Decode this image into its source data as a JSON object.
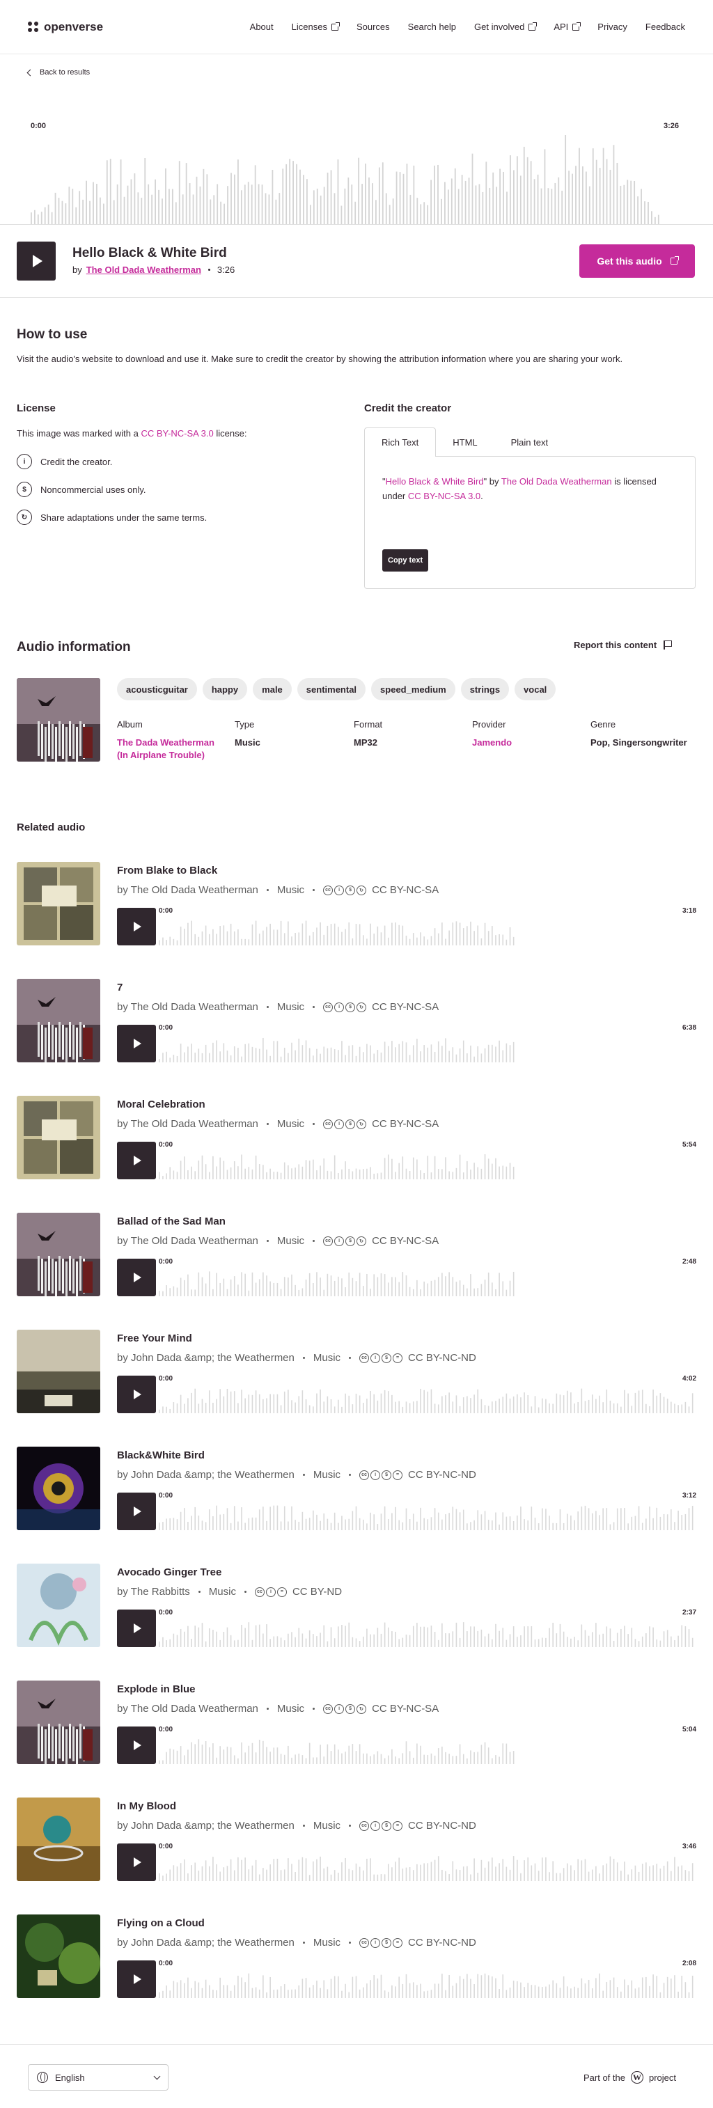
{
  "header": {
    "brand": "openverse",
    "nav": [
      {
        "label": "About",
        "external": false
      },
      {
        "label": "Licenses",
        "external": true
      },
      {
        "label": "Sources",
        "external": false
      },
      {
        "label": "Search help",
        "external": false
      },
      {
        "label": "Get involved",
        "external": true
      },
      {
        "label": "API",
        "external": true
      },
      {
        "label": "Privacy",
        "external": false
      },
      {
        "label": "Feedback",
        "external": false
      }
    ]
  },
  "back_link": "Back to results",
  "player": {
    "current_time": "0:00",
    "duration": "3:26",
    "title": "Hello Black & White Bird",
    "by": "by",
    "creator": "The Old Dada Weatherman",
    "time": "3:26",
    "get_button": "Get this audio"
  },
  "how_to_use": {
    "heading": "How to use",
    "description": "Visit the audio's website to download and use it. Make sure to credit the creator by showing the attribution information where you are sharing your work."
  },
  "license": {
    "heading": "License",
    "intro_prefix": "This image was marked with a",
    "license_name": "CC BY-NC-SA 3.0",
    "intro_suffix": "license:",
    "terms": [
      {
        "icon": "cc-by-icon",
        "glyph": "i",
        "text": "Credit the creator."
      },
      {
        "icon": "cc-nc-icon",
        "glyph": "$",
        "text": "Noncommercial uses only."
      },
      {
        "icon": "cc-sa-icon",
        "glyph": "↻",
        "text": "Share adaptations under the same terms."
      }
    ]
  },
  "credit": {
    "heading": "Credit the creator",
    "tabs": [
      "Rich Text",
      "HTML",
      "Plain text"
    ],
    "active_tab": "Rich Text",
    "quote_open": "\"",
    "title_link": "Hello Black & White Bird",
    "quote_close": "\" by ",
    "creator_link": "The Old Dada Weatherman",
    "middle": " is licensed under ",
    "license_link": "CC BY-NC-SA 3.0",
    "end": ".",
    "copy_button": "Copy text"
  },
  "audio_info": {
    "heading": "Audio information",
    "report": "Report this content",
    "tags": [
      "acousticguitar",
      "happy",
      "male",
      "sentimental",
      "speed_medium",
      "strings",
      "vocal"
    ],
    "meta": [
      {
        "label": "Album",
        "value": "The Dada Weatherman (In Airplane Trouble)",
        "link": true
      },
      {
        "label": "Type",
        "value": "Music",
        "link": false
      },
      {
        "label": "Format",
        "value": "MP32",
        "link": false
      },
      {
        "label": "Provider",
        "value": "Jamendo",
        "link": true
      },
      {
        "label": "Genre",
        "value": "Pop, Singersongwriter",
        "link": false
      }
    ]
  },
  "related": {
    "heading": "Related audio",
    "items": [
      {
        "title": "From Blake to Black",
        "creator": "by The Old Dada Weatherman",
        "type": "Music",
        "icons": [
          "cc",
          "i",
          "$",
          "↻"
        ],
        "license": "CC BY-NC-SA",
        "start": "0:00",
        "duration": "3:18",
        "art": "poster"
      },
      {
        "title": "7",
        "creator": "by The Old Dada Weatherman",
        "type": "Music",
        "icons": [
          "cc",
          "i",
          "$",
          "↻"
        ],
        "license": "CC BY-NC-SA",
        "start": "0:00",
        "duration": "6:38",
        "art": "bird"
      },
      {
        "title": "Moral Celebration",
        "creator": "by The Old Dada Weatherman",
        "type": "Music",
        "icons": [
          "cc",
          "i",
          "$",
          "↻"
        ],
        "license": "CC BY-NC-SA",
        "start": "0:00",
        "duration": "5:54",
        "art": "poster"
      },
      {
        "title": "Ballad of the Sad Man",
        "creator": "by The Old Dada Weatherman",
        "type": "Music",
        "icons": [
          "cc",
          "i",
          "$",
          "↻"
        ],
        "license": "CC BY-NC-SA",
        "start": "0:00",
        "duration": "2:48",
        "art": "bird"
      },
      {
        "title": "Free Your Mind",
        "creator": "by John Dada &amp; the Weathermen",
        "type": "Music",
        "icons": [
          "cc",
          "i",
          "$",
          "="
        ],
        "license": "CC BY-NC-ND",
        "start": "0:00",
        "duration": "4:02",
        "art": "field"
      },
      {
        "title": "Black&White Bird",
        "creator": "by John Dada &amp; the Weathermen",
        "type": "Music",
        "icons": [
          "cc",
          "i",
          "$",
          "="
        ],
        "license": "CC BY-NC-ND",
        "start": "0:00",
        "duration": "3:12",
        "art": "flower"
      },
      {
        "title": "Avocado Ginger Tree",
        "creator": "by The Rabbitts",
        "type": "Music",
        "icons": [
          "cc",
          "i",
          "="
        ],
        "license": "CC BY-ND",
        "start": "0:00",
        "duration": "2:37",
        "art": "drawing"
      },
      {
        "title": "Explode in Blue",
        "creator": "by The Old Dada Weatherman",
        "type": "Music",
        "icons": [
          "cc",
          "i",
          "$",
          "↻"
        ],
        "license": "CC BY-NC-SA",
        "start": "0:00",
        "duration": "5:04",
        "art": "bird"
      },
      {
        "title": "In My Blood",
        "creator": "by John Dada &amp; the Weathermen",
        "type": "Music",
        "icons": [
          "cc",
          "i",
          "$",
          "="
        ],
        "license": "CC BY-NC-ND",
        "start": "0:00",
        "duration": "3:46",
        "art": "orb"
      },
      {
        "title": "Flying on a Cloud",
        "creator": "by John Dada &amp; the Weathermen",
        "type": "Music",
        "icons": [
          "cc",
          "i",
          "$",
          "="
        ],
        "license": "CC BY-NC-ND",
        "start": "0:00",
        "duration": "2:08",
        "art": "forest"
      }
    ]
  },
  "footer": {
    "language": "English",
    "part_of_prefix": "Part of the",
    "part_of_suffix": "project"
  },
  "colors": {
    "accent": "#c52b9b",
    "dark": "#30272e",
    "wave": "#d9d9d9",
    "wave_played": "#a0a0a0"
  }
}
